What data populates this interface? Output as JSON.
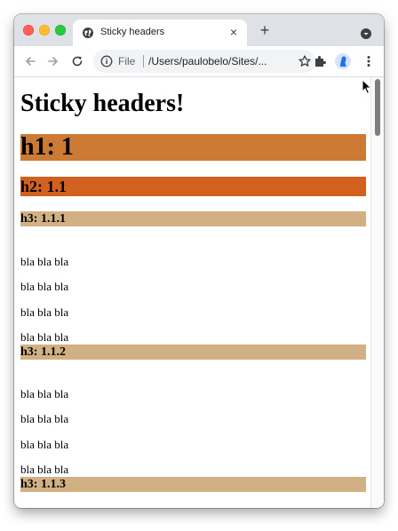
{
  "window": {
    "tab_title": "Sticky headers",
    "tab_close_glyph": "×",
    "new_tab_glyph": "+"
  },
  "toolbar": {
    "scheme_label": "File",
    "url": "/Users/paulobelo/Sites/..."
  },
  "page": {
    "title": "Sticky headers!",
    "h1": "h1: 1",
    "h2": "h2: 1.1",
    "sections": [
      {
        "heading": "h3: 1.1.1",
        "paragraphs": [
          "bla bla bla",
          "bla bla bla",
          "bla bla bla",
          "bla bla bla"
        ]
      },
      {
        "heading": "h3: 1.1.2",
        "paragraphs": [
          "bla bla bla",
          "bla bla bla",
          "bla bla bla",
          "bla bla bla"
        ]
      },
      {
        "heading": "h3: 1.1.3",
        "paragraphs": []
      }
    ]
  },
  "colors": {
    "h1_bg": "#cd7a35",
    "h2_bg": "#d2611f",
    "h3_bg": "#d1b084",
    "tabbar_bg": "#dee1e6"
  },
  "icons": [
    "globe-icon",
    "close-icon",
    "plus-icon",
    "tab-search-icon",
    "back-arrow-icon",
    "forward-arrow-icon",
    "reload-icon",
    "info-icon",
    "star-icon",
    "extensions-puzzle-icon",
    "profile-avatar-icon",
    "kebab-menu-icon",
    "mouse-cursor-icon"
  ]
}
